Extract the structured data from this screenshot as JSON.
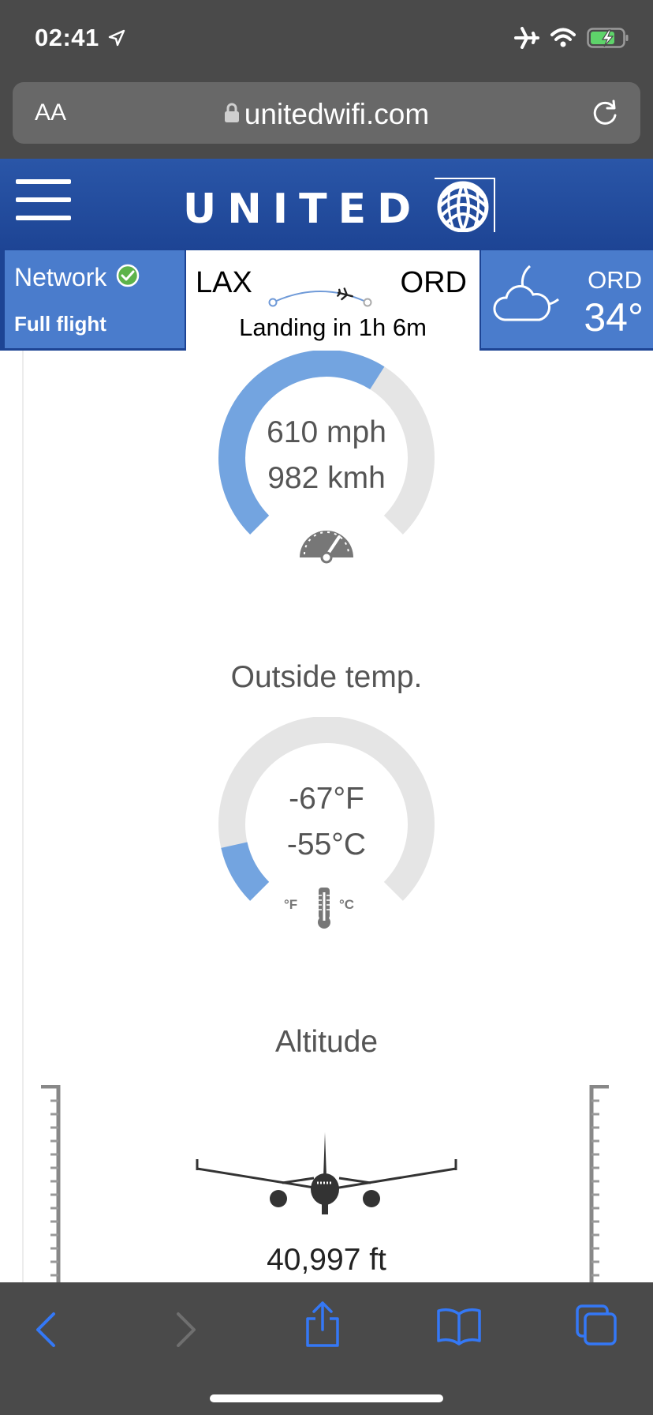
{
  "status_bar": {
    "time": "02:41",
    "icons": [
      "location-arrow-icon",
      "airplane-mode-icon",
      "wifi-icon",
      "battery-charging-icon"
    ]
  },
  "browser": {
    "text_size_button": "AA",
    "url": "unitedwifi.com",
    "icons": [
      "lock-icon",
      "reload-icon"
    ]
  },
  "header": {
    "brand": "UNITED",
    "icons": [
      "hamburger-menu-icon",
      "united-globe-logo"
    ]
  },
  "network": {
    "label": "Network",
    "plan": "Full flight",
    "status_icon": "check-circle-icon"
  },
  "route": {
    "origin": "LAX",
    "destination": "ORD",
    "landing": "Landing in 1h 6m",
    "progress": 0.76
  },
  "weather": {
    "city": "ORD",
    "temperature": "34°",
    "icon": "moon-cloud-icon"
  },
  "speed": {
    "mph": "610 mph",
    "kmh": "982 kmh",
    "level": 0.62,
    "icon": "speedometer-icon"
  },
  "outside_temp": {
    "title": "Outside temp.",
    "fahrenheit": "-67°F",
    "celsius": "-55°C",
    "level": 0.12,
    "icon": "thermometer-icon",
    "unit_f": "°F",
    "unit_c": "°C"
  },
  "altitude": {
    "title": "Altitude",
    "value": "40,997 ft",
    "icon": "airplane-front-icon"
  },
  "toolbar": {
    "icons": [
      "back-icon",
      "forward-icon",
      "share-icon",
      "bookmarks-icon",
      "tabs-icon"
    ]
  },
  "colors": {
    "header_blue": "#1d4494",
    "panel_blue": "#4a7ccc",
    "gauge_blue": "#73a4e0",
    "gauge_track": "#e5e5e5",
    "chrome_gray": "#4a4a4a",
    "ios_blue": "#3478f6"
  }
}
